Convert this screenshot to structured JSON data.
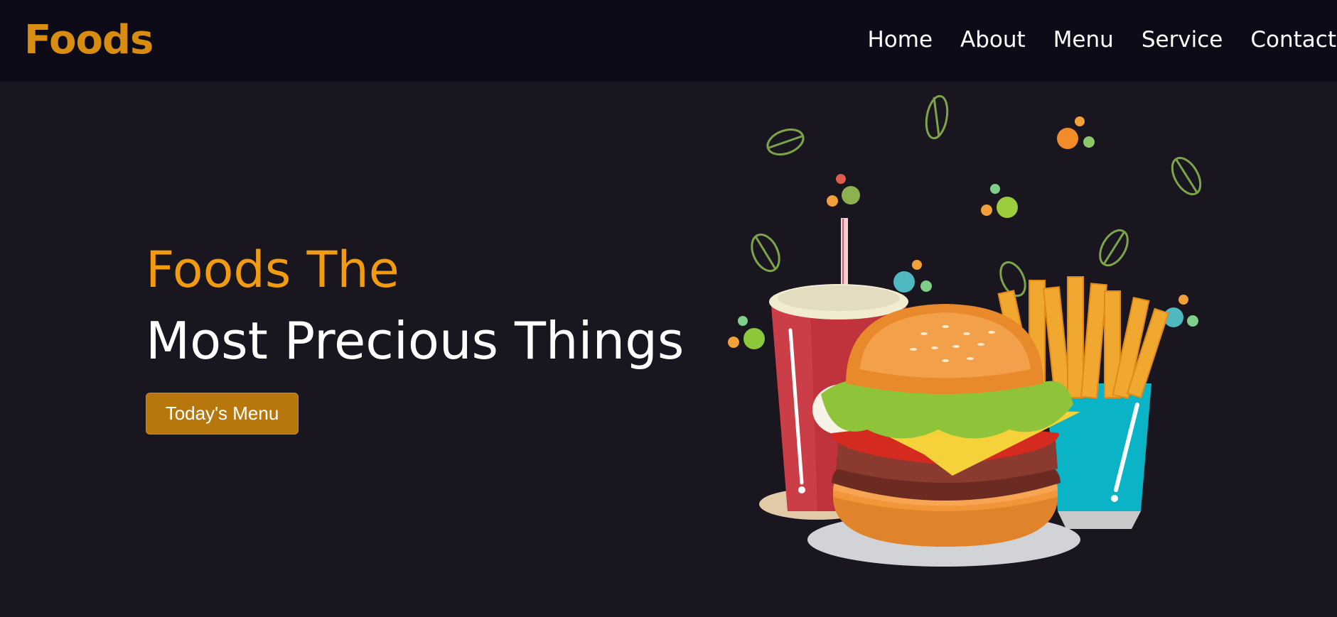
{
  "brand": {
    "logo_text": "Foods"
  },
  "nav": {
    "items": [
      {
        "label": "Home"
      },
      {
        "label": "About"
      },
      {
        "label": "Menu"
      },
      {
        "label": "Service"
      },
      {
        "label": "Contact"
      }
    ]
  },
  "hero": {
    "headline_accent": "Foods The",
    "headline_main": "Most Precious Things",
    "cta_label": "Today's Menu",
    "illustration": "burger-fries-drink-illustration"
  },
  "colors": {
    "page_background": "#19161f",
    "nav_background": "#0d0b18",
    "brand_orange": "#d98d10",
    "headline_orange": "#f39b10",
    "button_background": "#b8770c",
    "text_white": "#ffffff"
  }
}
